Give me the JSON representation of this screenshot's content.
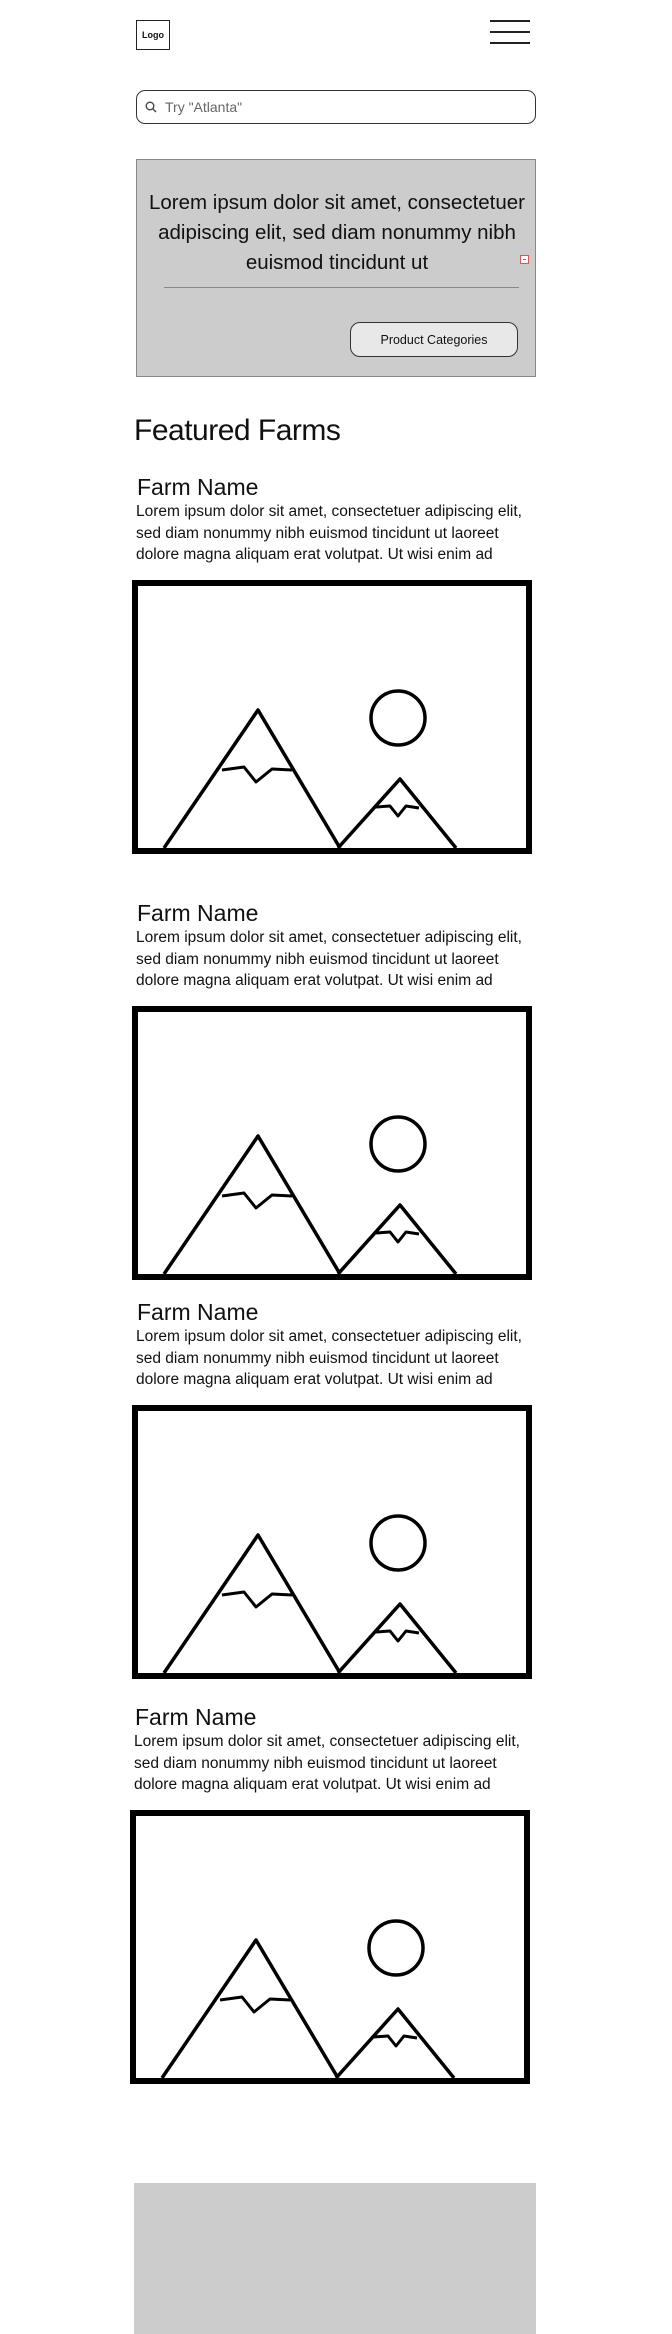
{
  "header": {
    "logo_text": "Logo",
    "menu_icon": "hamburger-menu-icon"
  },
  "search": {
    "placeholder": "Try \"Atlanta\"",
    "icon": "search-icon"
  },
  "hero": {
    "text": "Lorem ipsum dolor sit amet, consectetuer adipiscing elit, sed diam nonummy nibh euismod tincidunt ut",
    "button_label": "Product Categories"
  },
  "featured": {
    "title": "Featured Farms",
    "farms": [
      {
        "name": "Farm Name",
        "description": "Lorem ipsum dolor sit amet, consectetuer adipiscing elit, sed diam nonummy nibh euismod tincidunt ut laoreet dolore magna aliquam erat volutpat. Ut wisi enim ad",
        "image_icon": "image-placeholder-icon"
      },
      {
        "name": "Farm Name",
        "description": "Lorem ipsum dolor sit amet, consectetuer adipiscing elit, sed diam nonummy nibh euismod tincidunt ut laoreet dolore magna aliquam erat volutpat. Ut wisi enim ad",
        "image_icon": "image-placeholder-icon"
      },
      {
        "name": "Farm Name",
        "description": "Lorem ipsum dolor sit amet, consectetuer adipiscing elit, sed diam nonummy nibh euismod tincidunt ut laoreet dolore magna aliquam erat volutpat. Ut wisi enim ad",
        "image_icon": "image-placeholder-icon"
      },
      {
        "name": "Farm Name",
        "description": "Lorem ipsum dolor sit amet, consectetuer adipiscing elit, sed diam nonummy nibh euismod tincidunt ut laoreet dolore magna aliquam erat volutpat. Ut wisi enim ad",
        "image_icon": "image-placeholder-icon"
      }
    ]
  },
  "colors": {
    "panel_gray": "#cccccc",
    "button_gray": "#e8e8e8",
    "ink": "#111111"
  }
}
